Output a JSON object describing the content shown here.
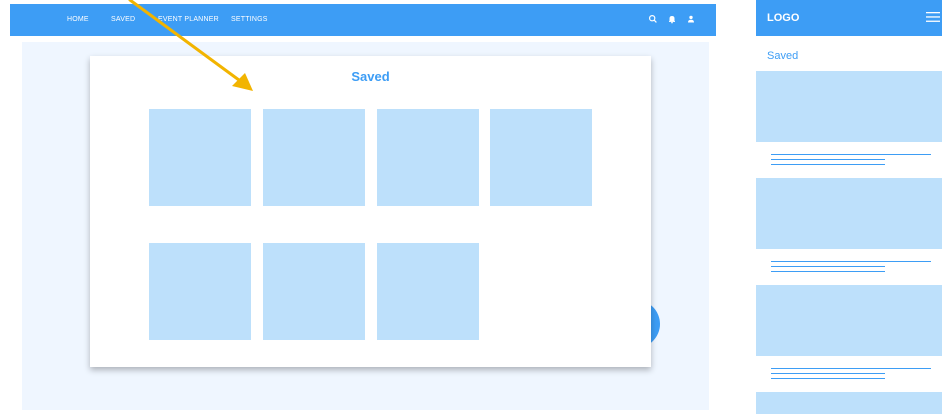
{
  "desktop": {
    "nav": {
      "items": [
        {
          "label": "HOME"
        },
        {
          "label": "SAVED"
        },
        {
          "label": "EVENT PLANNER"
        },
        {
          "label": "SETTINGS"
        }
      ],
      "icons": [
        "search-icon",
        "bell-icon",
        "user-icon"
      ]
    },
    "modal": {
      "title": "Saved",
      "tile_count": 7
    }
  },
  "mobile": {
    "header": {
      "logo": "LOGO",
      "menu_icon": "hamburger-icon"
    },
    "title": "Saved"
  },
  "colors": {
    "primary": "#3d9df5",
    "tile": "#bde0fb",
    "page_background": "#eff6ff",
    "annotation_arrow": "#f2b400"
  }
}
